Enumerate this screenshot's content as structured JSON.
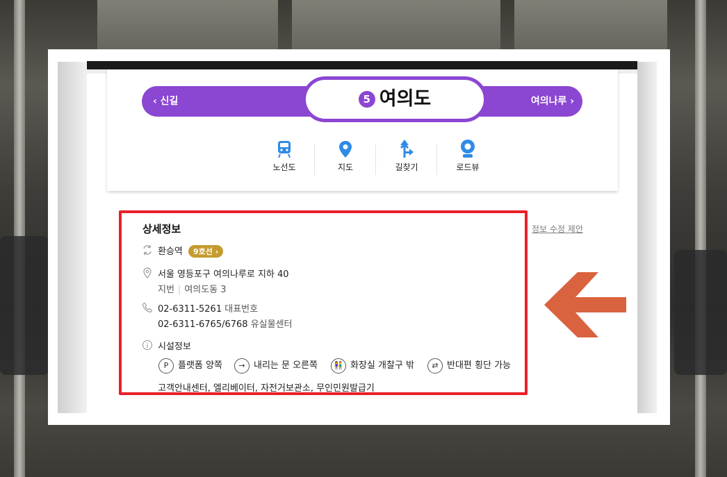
{
  "station": {
    "line_number": "5",
    "name": "여의도",
    "prev": "신길",
    "next": "여의나루",
    "line_color": "#8b46d2"
  },
  "tools": [
    {
      "label": "노선도",
      "icon": "train-icon"
    },
    {
      "label": "지도",
      "icon": "map-pin-icon"
    },
    {
      "label": "길찾기",
      "icon": "directions-icon"
    },
    {
      "label": "로드뷰",
      "icon": "roadview-icon"
    }
  ],
  "detail": {
    "title": "상세정보",
    "edit_link": "정보 수정 제안",
    "transfer_label": "환승역",
    "transfer_badge": "9호선",
    "address": "서울 영등포구 여의나루로 지하 40",
    "lot_label": "지번",
    "lot_value": "여의도동 3",
    "phone1": "02-6311-5261",
    "phone1_label": "대표번호",
    "phone2": "02-6311-6765/6768",
    "phone2_label": "유실물센터",
    "facility_title": "시설정보",
    "facilities": [
      {
        "label": "플랫폼 양쪽",
        "icon_glyph": "P"
      },
      {
        "label": "내리는 문 오른쪽",
        "icon_glyph": "→"
      },
      {
        "label": "화장실 개찰구 밖",
        "icon_glyph": "👫"
      },
      {
        "label": "반대편 횡단 가능",
        "icon_glyph": "⇄"
      }
    ],
    "facility_extra": "고객안내센터, 엘리베이터, 자전거보관소, 무인민원발급기"
  },
  "colors": {
    "highlight_border": "#e8202a",
    "arrow": "#d9623f",
    "badge": "#c59b2f",
    "icon_blue": "#2f8be6"
  }
}
